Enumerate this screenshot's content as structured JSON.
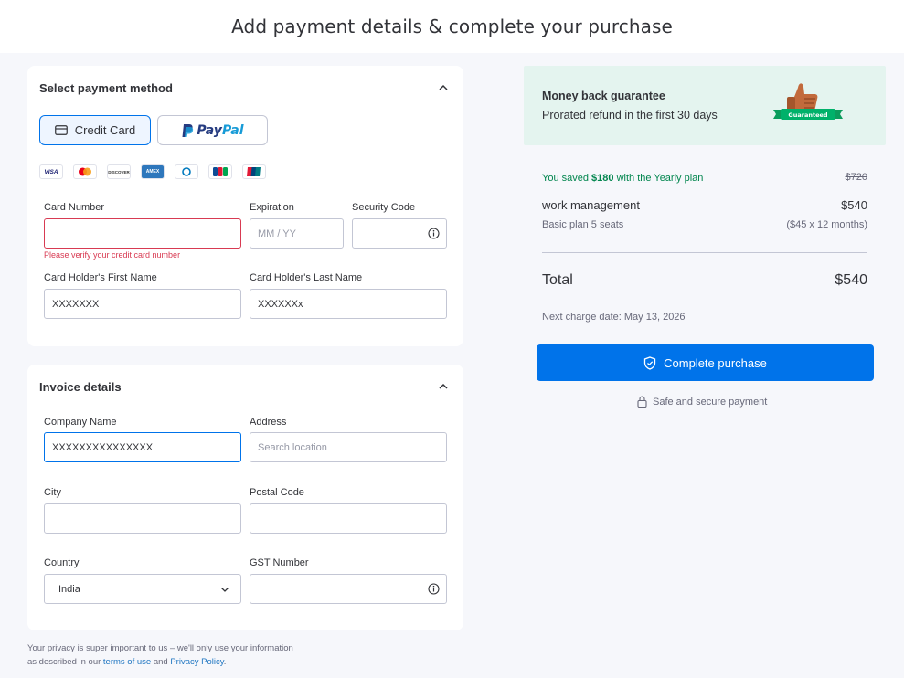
{
  "header": {
    "title": "Add payment details & complete your purchase"
  },
  "payment": {
    "title": "Select payment method",
    "credit_card_label": "Credit Card",
    "paypal_pay": "Pay",
    "paypal_pal": "Pal",
    "brands": [
      "VISA",
      "Mastercard",
      "DISCOVER",
      "AMEX",
      "Diners",
      "JCB",
      "UnionPay"
    ],
    "card_number_label": "Card Number",
    "card_number_value": "",
    "card_number_error": "Please verify your credit card number",
    "expiration_label": "Expiration",
    "expiration_placeholder": "MM / YY",
    "security_code_label": "Security Code",
    "security_code_value": "",
    "first_name_label": "Card Holder's First Name",
    "first_name_value": "XXXXXXX",
    "last_name_label": "Card Holder's Last Name",
    "last_name_value": "XXXXXXx"
  },
  "invoice": {
    "title": "Invoice details",
    "company_label": "Company Name",
    "company_value": "XXXXXXXXXXXXXXX",
    "address_label": "Address",
    "address_placeholder": "Search location",
    "city_label": "City",
    "city_value": "",
    "postal_label": "Postal Code",
    "postal_value": "",
    "country_label": "Country",
    "country_value": "India",
    "gst_label": "GST Number",
    "gst_value": ""
  },
  "privacy": {
    "line1": "Your privacy is super important to us – we'll only use your information",
    "line2_prefix": "as described in our",
    "terms_link": "terms of use",
    "and": "and",
    "policy_link": "Privacy Policy",
    "end": "."
  },
  "guarantee": {
    "title": "Money back guarantee",
    "subtitle": "Prorated refund in the first 30 days",
    "badge": "Guaranteed"
  },
  "summary": {
    "saved_prefix": "You saved",
    "saved_amount": "$180",
    "saved_suffix": "with the Yearly plan",
    "original_price": "$720",
    "product": "work management",
    "product_price": "$540",
    "plan": "Basic plan 5 seats",
    "plan_detail": "($45 x 12 months)",
    "total_label": "Total",
    "total_value": "$540",
    "next_charge": "Next charge date: May 13, 2026",
    "cta": "Complete purchase",
    "secure": "Safe and secure payment"
  },
  "colors": {
    "accent": "#0073ea",
    "error": "#d83a52",
    "success": "#00854d",
    "guarantee_bg": "#e4f4ef"
  }
}
